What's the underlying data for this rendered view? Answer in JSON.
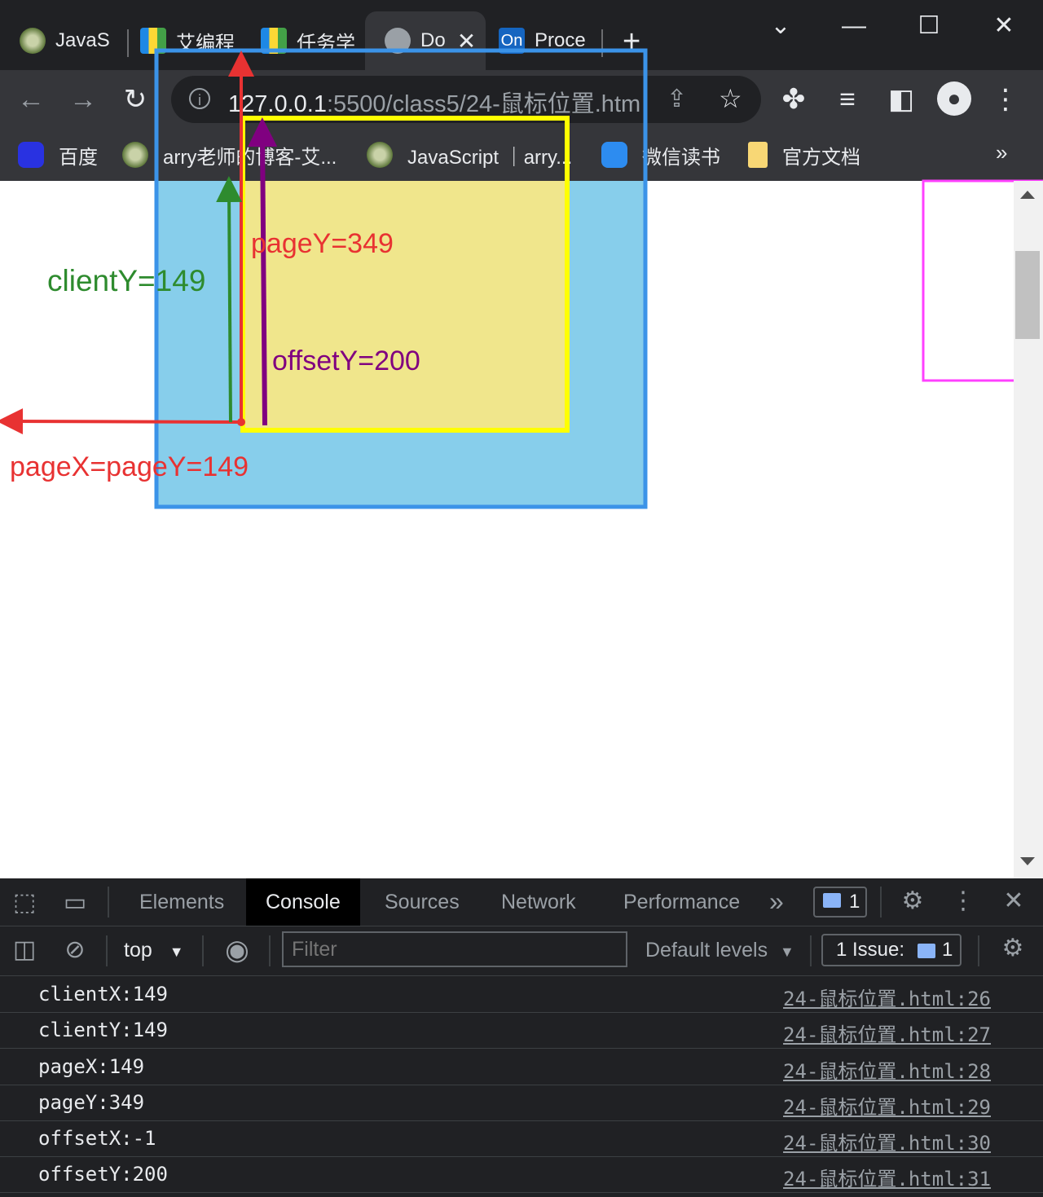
{
  "browser": {
    "tabs": [
      {
        "label": "JavaS"
      },
      {
        "label": "艾编程"
      },
      {
        "label": "任务学"
      },
      {
        "label": "Do"
      },
      {
        "label": "Proce"
      }
    ],
    "tab5_icon_text": "On",
    "new_tab": "+",
    "url_host": "127.0.0.1",
    "url_path": ":5500/class5/24-鼠标位置.htm"
  },
  "bookmarks": [
    {
      "label": "百度"
    },
    {
      "label": "arry老师的博客-艾..."
    },
    {
      "label": "JavaScript ｜arry..."
    },
    {
      "label": "微信读书"
    },
    {
      "label": "官方文档"
    }
  ],
  "bookmarks_more": "»",
  "annotations": {
    "pageY": "pageY=349",
    "clientY": "clientY=149",
    "offsetY": "offsetY=200",
    "pageXY": "pageX=pageY=149"
  },
  "devtools": {
    "tabs": [
      "Elements",
      "Console",
      "Sources",
      "Network",
      "Performance"
    ],
    "more": "»",
    "messages_badge": "1",
    "context": "top",
    "filter_placeholder": "Filter",
    "levels": "Default levels",
    "issues_label": "1 Issue:",
    "issues_count": "1",
    "logs": [
      {
        "msg": "clientX:149",
        "src": "24-鼠标位置.html:26"
      },
      {
        "msg": "clientY:149",
        "src": "24-鼠标位置.html:27"
      },
      {
        "msg": "pageX:149",
        "src": "24-鼠标位置.html:28"
      },
      {
        "msg": "pageY:349",
        "src": "24-鼠标位置.html:29"
      },
      {
        "msg": "offsetX:-1",
        "src": "24-鼠标位置.html:30"
      },
      {
        "msg": "offsetY:200",
        "src": "24-鼠标位置.html:31"
      }
    ]
  },
  "colors": {
    "outer_box": "#87ceeb",
    "inner_box": "#f0e68c",
    "blue_outline": "#3b93e8",
    "yellow_outline": "#ffff00",
    "magenta_outline": "#ff40ff",
    "page_arrow": "#e83232",
    "client_arrow": "#2e8b2e",
    "offset_arrow": "#800080"
  }
}
